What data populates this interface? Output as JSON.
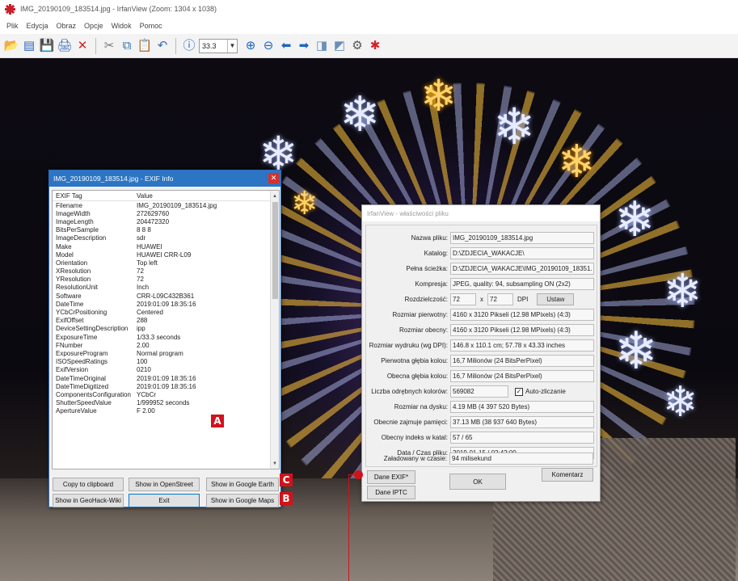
{
  "window": {
    "title": "IMG_20190109_183514.jpg - IrfanView (Zoom: 1304 x 1038)"
  },
  "menu": [
    "Plik",
    "Edycja",
    "Obraz",
    "Opcje",
    "Widok",
    "Pomoc"
  ],
  "toolbar": {
    "zoom_value": "33.3"
  },
  "exif": {
    "title": "IMG_20190109_183514.jpg - EXIF Info",
    "columns": {
      "tag": "EXIF Tag",
      "value": "Value"
    },
    "rows": [
      [
        "Filename",
        "IMG_20190109_183514.jpg"
      ],
      [
        "ImageWidth",
        "272629760"
      ],
      [
        "ImageLength",
        "204472320"
      ],
      [
        "BitsPerSample",
        "8 8 8"
      ],
      [
        "ImageDescription",
        "sdr"
      ],
      [
        "Make",
        "HUAWEI"
      ],
      [
        "Model",
        "HUAWEI CRR-L09"
      ],
      [
        "Orientation",
        "Top left"
      ],
      [
        "XResolution",
        "72"
      ],
      [
        "YResolution",
        "72"
      ],
      [
        "ResolutionUnit",
        "Inch"
      ],
      [
        "Software",
        "CRR-L09C432B361"
      ],
      [
        "DateTime",
        "2019:01:09 18:35:16"
      ],
      [
        "YCbCrPositioning",
        "Centered"
      ],
      [
        "ExifOffset",
        "288"
      ],
      [
        "DeviceSettingDescription",
        "ipp"
      ],
      [
        "ExposureTime",
        "1/33.3 seconds"
      ],
      [
        "FNumber",
        "2.00"
      ],
      [
        "ExposureProgram",
        "Normal program"
      ],
      [
        "ISOSpeedRatings",
        "100"
      ],
      [
        "ExifVersion",
        "0210"
      ],
      [
        "DateTimeOriginal",
        "2019:01:09 18:35:16"
      ],
      [
        "DateTimeDigitized",
        "2019:01:09 18:35:16"
      ],
      [
        "ComponentsConfiguration",
        "YCbCr"
      ],
      [
        "ShutterSpeedValue",
        "1/999952 seconds"
      ],
      [
        "ApertureValue",
        "F 2.00"
      ]
    ],
    "buttons": {
      "copy": "Copy to clipboard",
      "openstreet": "Show in OpenStreet",
      "google_earth": "Show in Google Earth",
      "geohack": "Show in GeoHack-Wiki",
      "exit": "Exit",
      "google_maps": "Show in Google Maps"
    }
  },
  "props": {
    "title": "IrfanView - właściwości pliku",
    "fields": {
      "name_label": "Nazwa pliku:",
      "name": "IMG_20190109_183514.jpg",
      "dir_label": "Katalog:",
      "dir": "D:\\ZDJECIA_WAKACJE\\",
      "path_label": "Pełna ścieżka:",
      "path": "D:\\ZDJECIA_WAKACJE\\IMG_20190109_18351.",
      "comp_label": "Kompresja:",
      "comp": "JPEG, quality: 94, subsampling ON (2x2)",
      "res_label": "Rozdzielczość:",
      "res_x": "72",
      "res_sep": "x",
      "res_y": "72",
      "res_unit": "DPI",
      "set_button": "Ustaw",
      "orig_size_label": "Rozmiar pierwotny:",
      "orig_size": "4160 x 3120  Pikseli (12.98 MPixels) (4:3)",
      "cur_size_label": "Rozmiar obecny:",
      "cur_size": "4160 x 3120  Pikseli (12.98 MPixels) (4:3)",
      "print_label": "Rozmiar wydruku (wg DPI):",
      "print": "146.8 x 110.1 cm; 57.78 x 43.33 inches",
      "orig_depth_label": "Pierwotna głębia kolou:",
      "orig_depth": "16,7 Milionów   (24 BitsPerPixel)",
      "cur_depth_label": "Obecna głębia kolou:",
      "cur_depth": "16,7 Milionów   (24 BitsPerPixel)",
      "colors_label": "Liczba odrębnych kolorów:",
      "colors": "569082",
      "autocount_label": "Auto-zliczanie",
      "disk_label": "Rozmiar na dysku:",
      "disk": "4.19 MB (4 397 520 Bytes)",
      "mem_label": "Obecnie zajmuje pamięci:",
      "mem": "37.13  MB (38 937 640 Bytes)",
      "index_label": "Obecny indeks w katal:",
      "index": "57  /  65",
      "date_label": "Data / Czas pliku:",
      "date": "2019-01-15 / 02:42:00",
      "load_label": "Załadowany w czasie:",
      "load": "94 milisekund"
    },
    "buttons": {
      "exif": "Dane EXIF*",
      "iptc": "Dane IPTC",
      "ok": "OK",
      "comment": "Komentarz"
    }
  },
  "markers": {
    "a": "A",
    "b": "B",
    "c": "C"
  },
  "colors": {
    "accent": "#2b75c4",
    "marker": "#d2121b"
  }
}
